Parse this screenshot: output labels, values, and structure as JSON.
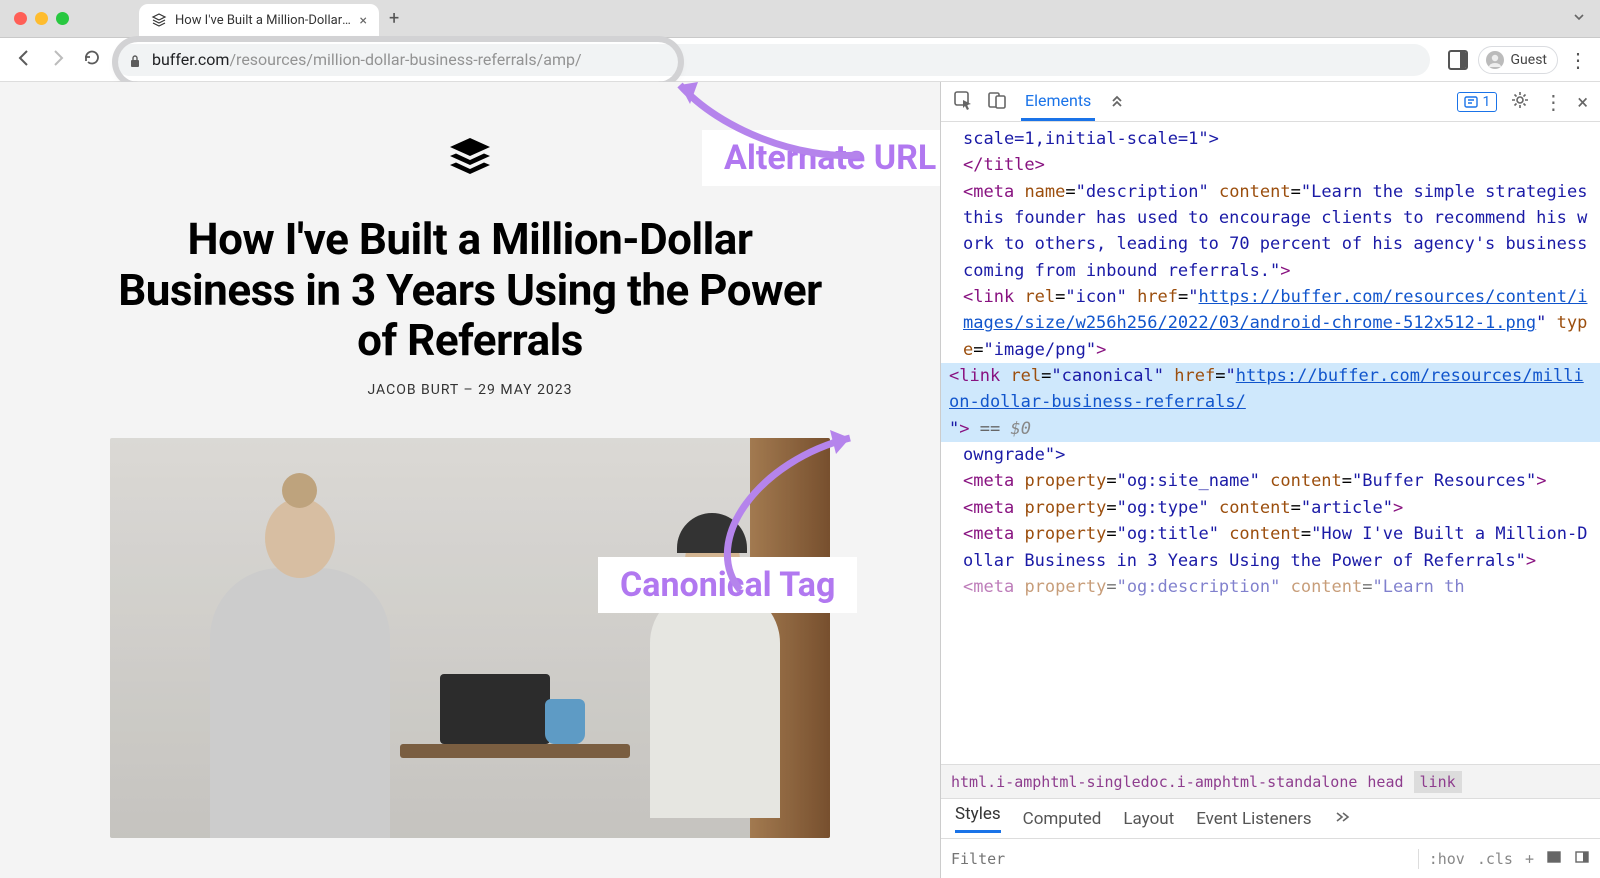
{
  "chrome": {
    "tab_title": "How I've Built a Million-Dollar B",
    "url_host": "buffer.com",
    "url_path": "/resources/million-dollar-business-referrals/amp/",
    "guest_label": "Guest"
  },
  "article": {
    "title": "How I've Built a Million-Dollar Business in 3 Years Using the Power of Referrals",
    "author": "JACOB BURT",
    "date": "29 MAY 2023"
  },
  "annotations": {
    "alternate": "Alternate URL",
    "canonical": "Canonical Tag"
  },
  "devtools": {
    "tabs": {
      "elements": "Elements"
    },
    "badge_count": "1",
    "code": {
      "viewport_tail": "scale=1,initial-scale=1\">",
      "title_close": "</title>",
      "meta_desc_open": "<meta name=\"description\" content=\"",
      "meta_desc_text": "Learn the simple strategies this founder has used to encourage clients to recommend his work to others, leading to 70 percent of his agency's business coming from inbound referrals.",
      "meta_desc_close": "\">",
      "link_icon_open": "<link rel=\"icon\" href=\"",
      "link_icon_url": "https://buffer.com/resources/content/images/size/w256h256/2022/03/android-chrome-512x512-1.png",
      "link_icon_close": "\" type=\"image/png\">",
      "canonical_open": "<link rel=\"canonical\" href=\"",
      "canonical_url": "https://buffer.com/resources/million-dollar-business-referrals/",
      "canonical_close": "\"> ",
      "canonical_eq": "== ",
      "canonical_dollar": "$0",
      "owngrade_tail": "owngrade\">",
      "og_sitename": "<meta property=\"og:site_name\" content=\"Buffer Resources\">",
      "og_type": "<meta property=\"og:type\" content=\"article\">",
      "og_title": "<meta property=\"og:title\" content=\"How I've Built a Million-Dollar Business in 3 Years Using the Power of Referrals\">",
      "og_desc_partial": "<meta property=\"og:description\" content=\"Learn th"
    },
    "breadcrumb": {
      "b1": "html.i-amphtml-singledoc.i-amphtml-standalone",
      "b2": "head",
      "b3": "link"
    },
    "styles_tabs": {
      "styles": "Styles",
      "computed": "Computed",
      "layout": "Layout",
      "events": "Event Listeners"
    },
    "footer": {
      "filter_placeholder": "Filter",
      "hov": ":hov",
      "cls": ".cls"
    }
  }
}
